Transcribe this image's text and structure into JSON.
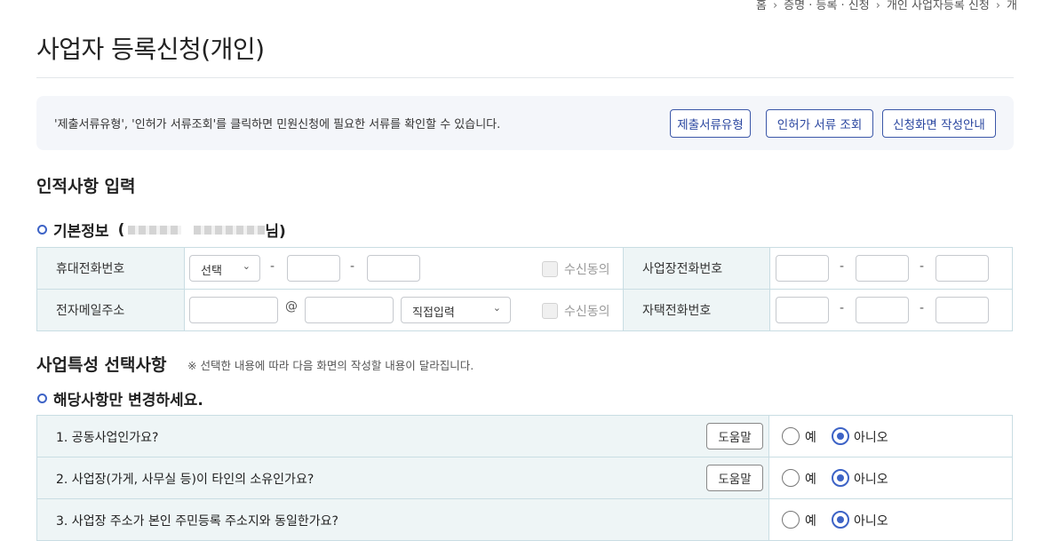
{
  "breadcrumb": [
    "홈",
    "증명 · 등록 · 신청",
    "개인 사업자등록 신청",
    "개"
  ],
  "page_title": "사업자 등록신청(개인)",
  "notice": {
    "text": "'제출서류유형', '인허가 서류조회'를 클릭하면 민원신청에 필요한 서류를 확인할 수 있습니다.",
    "buttons": [
      "제출서류유형",
      "인허가 서류 조회",
      "신청화면 작성안내"
    ]
  },
  "personal_section": {
    "title": "인적사항 입력",
    "basic_info_label": "기본정보",
    "basic_info_open": "(",
    "basic_info_suffix": "님)",
    "mobile_label": "휴대전화번호",
    "mobile_select": "선택",
    "email_label": "전자메일주소",
    "email_at": "@",
    "email_domain_select": "직접입력",
    "consent_label": "수신동의",
    "business_phone_label": "사업장전화번호",
    "home_phone_label": "자택전화번호",
    "dash": "-"
  },
  "business_section": {
    "title": "사업특성 선택사항",
    "note": "※ 선택한 내용에 따라 다음 화면의 작성할 내용이 달라집니다.",
    "subtitle": "해당사항만 변경하세요.",
    "help_label": "도움말",
    "yes_label": "예",
    "no_label": "아니오",
    "questions": [
      {
        "text": "1. 공동사업인가요?",
        "answer": "아니오"
      },
      {
        "text": "2. 사업장(가게, 사무실 등)이 타인의 소유인가요?",
        "answer": "아니오"
      },
      {
        "text": "3. 사업장 주소가 본인 주민등록 주소지와 동일한가요?",
        "answer": "아니오"
      }
    ]
  }
}
